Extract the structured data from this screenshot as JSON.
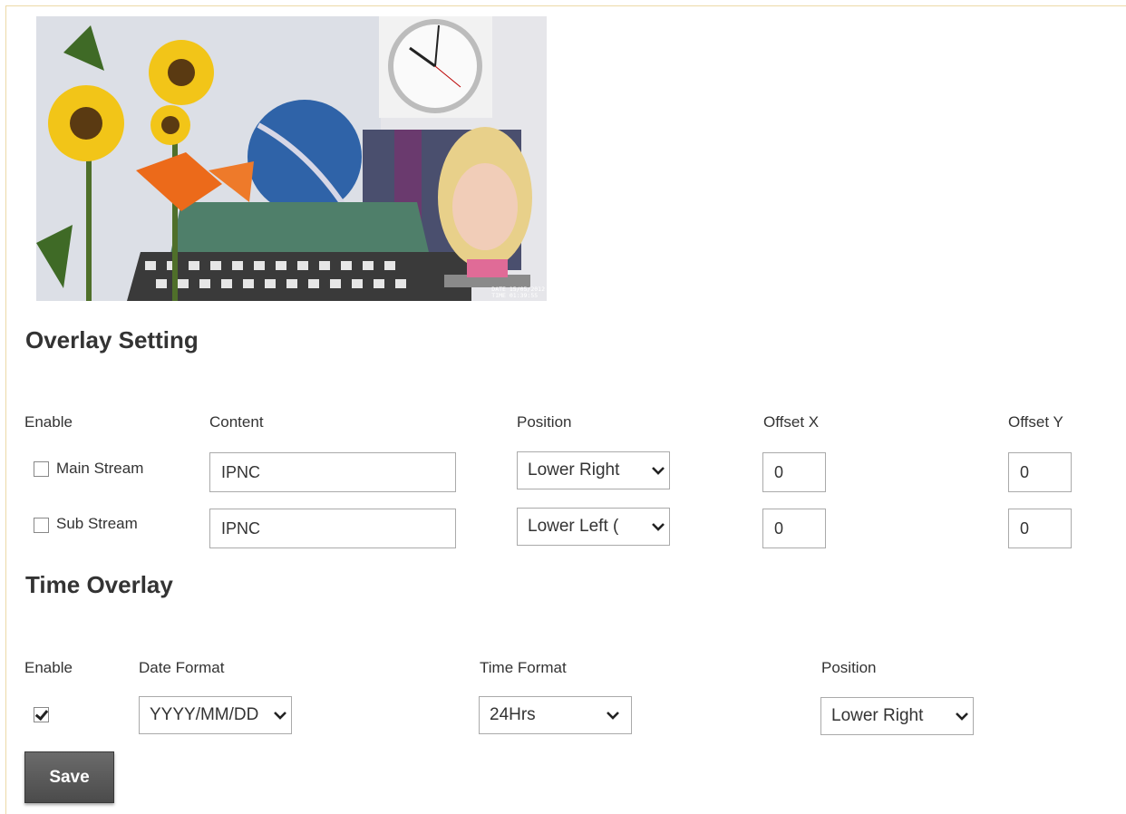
{
  "preview": {
    "osd_date": "DATE 15/05/2012",
    "osd_time": "TIME 01:39:55"
  },
  "overlay_setting": {
    "title": "Overlay Setting",
    "headers": {
      "enable": "Enable",
      "content": "Content",
      "position": "Position",
      "offset_x": "Offset X",
      "offset_y": "Offset Y"
    },
    "rows": [
      {
        "label": "Main Stream",
        "enabled": false,
        "content": "IPNC",
        "position": "Lower Right",
        "offset_x": "0",
        "offset_y": "0"
      },
      {
        "label": "Sub Stream",
        "enabled": false,
        "content": "IPNC",
        "position": "Lower Left (",
        "offset_x": "0",
        "offset_y": "0"
      }
    ]
  },
  "time_overlay": {
    "title": "Time Overlay",
    "headers": {
      "enable": "Enable",
      "date_format": "Date Format",
      "time_format": "Time Format",
      "position": "Position"
    },
    "enabled": true,
    "date_format": "YYYY/MM/DD",
    "time_format": "24Hrs",
    "position": "Lower Right"
  },
  "save_label": "Save",
  "icons": {
    "dropdown": "chevron-down-icon"
  }
}
